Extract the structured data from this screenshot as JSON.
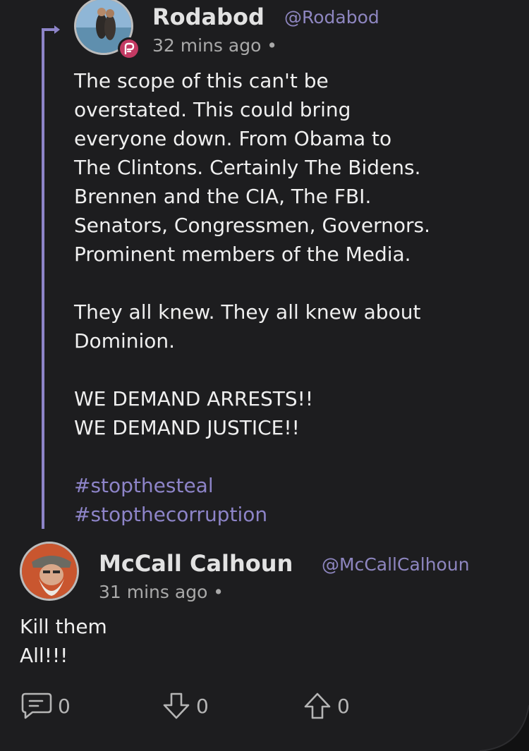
{
  "parent_post": {
    "display_name": "Rodabod",
    "handle": "@Rodabod",
    "timestamp": "32 mins ago •",
    "avatar_icon": "user-photo-avatar",
    "badge_icon": "parler-logo-icon",
    "lines": [
      "The scope of this can't be",
      "overstated. This could bring",
      "everyone down. From Obama to",
      "The Clintons. Certainly The Bidens.",
      "Brennen and the CIA, The FBI.",
      "Senators, Congressmen, Governors.",
      "Prominent members of the Media."
    ],
    "lines_2": [
      "They all knew. They all knew about",
      "Dominion."
    ],
    "lines_3": [
      "WE DEMAND ARRESTS!!",
      "WE DEMAND JUSTICE!!"
    ],
    "hashtags": [
      "#stopthesteal",
      "#stopthecorruption"
    ]
  },
  "reply_post": {
    "display_name": "McCall Calhoun",
    "handle": "@McCallCalhoun",
    "timestamp": "31 mins ago •",
    "avatar_icon": "user-photo-avatar",
    "lines": [
      "Kill them",
      "All!!!"
    ]
  },
  "actions": {
    "comment_icon": "comment-icon",
    "comment_count": "0",
    "downvote_icon": "downvote-arrow-icon",
    "downvote_count": "0",
    "upvote_icon": "upvote-arrow-icon",
    "upvote_count": "0"
  },
  "colors": {
    "background": "#1d1d1f",
    "accent": "#8d84c8",
    "text": "#efefef",
    "muted": "#a9a9a9",
    "badge": "#c33a63"
  }
}
